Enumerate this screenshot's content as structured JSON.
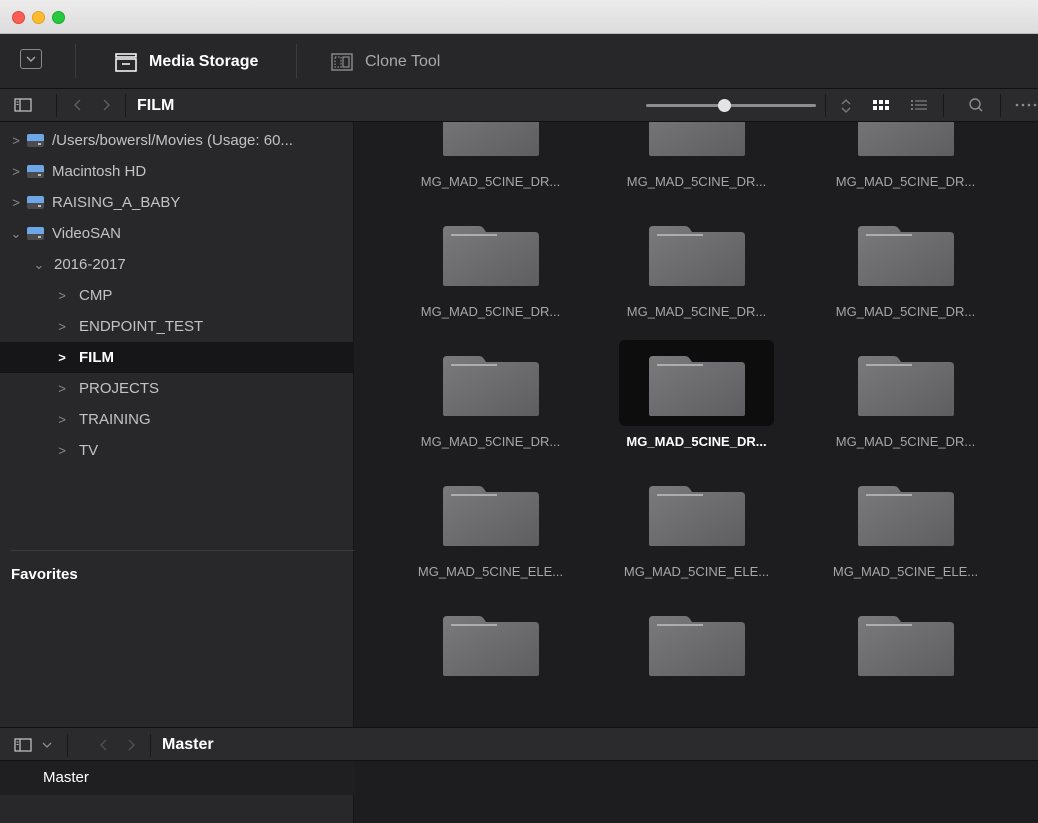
{
  "window": {
    "traffic_lights": [
      "close",
      "minimize",
      "zoom"
    ]
  },
  "toolbar": {
    "tabs": [
      {
        "label": "Media Storage",
        "icon": "media-storage-icon",
        "active": true
      },
      {
        "label": "Clone Tool",
        "icon": "clone-tool-icon",
        "active": false
      }
    ]
  },
  "pathbar": {
    "current_folder": "FILM"
  },
  "tree": [
    {
      "label": "/Users/bowersl/Movies (Usage: 60...",
      "type": "drive",
      "expanded": false
    },
    {
      "label": "Macintosh HD",
      "type": "drive",
      "expanded": false
    },
    {
      "label": "RAISING_A_BABY",
      "type": "drive",
      "expanded": false
    },
    {
      "label": "VideoSAN",
      "type": "drive",
      "expanded": true
    },
    {
      "label": "2016-2017",
      "type": "folder",
      "expanded": true
    },
    {
      "label": "CMP",
      "type": "folder",
      "expanded": false
    },
    {
      "label": "ENDPOINT_TEST",
      "type": "folder",
      "expanded": false
    },
    {
      "label": "FILM",
      "type": "folder",
      "expanded": false,
      "selected": true
    },
    {
      "label": "PROJECTS",
      "type": "folder",
      "expanded": false
    },
    {
      "label": "TRAINING",
      "type": "folder",
      "expanded": false
    },
    {
      "label": "TV",
      "type": "folder",
      "expanded": false
    }
  ],
  "favorites": {
    "label": "Favorites"
  },
  "grid": {
    "items": [
      {
        "label": "MG_MAD_5CINE_DR..."
      },
      {
        "label": "MG_MAD_5CINE_DR..."
      },
      {
        "label": "MG_MAD_5CINE_DR..."
      },
      {
        "label": "MG_MAD_5CINE_DR..."
      },
      {
        "label": "MG_MAD_5CINE_DR..."
      },
      {
        "label": "MG_MAD_5CINE_DR..."
      },
      {
        "label": "MG_MAD_5CINE_DR..."
      },
      {
        "label": "MG_MAD_5CINE_DR...",
        "selected": true
      },
      {
        "label": "MG_MAD_5CINE_DR..."
      },
      {
        "label": "MG_MAD_5CINE_ELE..."
      },
      {
        "label": "MG_MAD_5CINE_ELE..."
      },
      {
        "label": "MG_MAD_5CINE_ELE..."
      },
      {
        "label": ""
      },
      {
        "label": ""
      },
      {
        "label": ""
      }
    ]
  },
  "bin": {
    "title": "Master",
    "items": [
      {
        "label": "Master",
        "selected": true
      }
    ]
  },
  "colors": {
    "selection": "#161618",
    "drive_blue": "#6ea7e8",
    "panel": "#28282b",
    "background": "#1d1d20"
  }
}
